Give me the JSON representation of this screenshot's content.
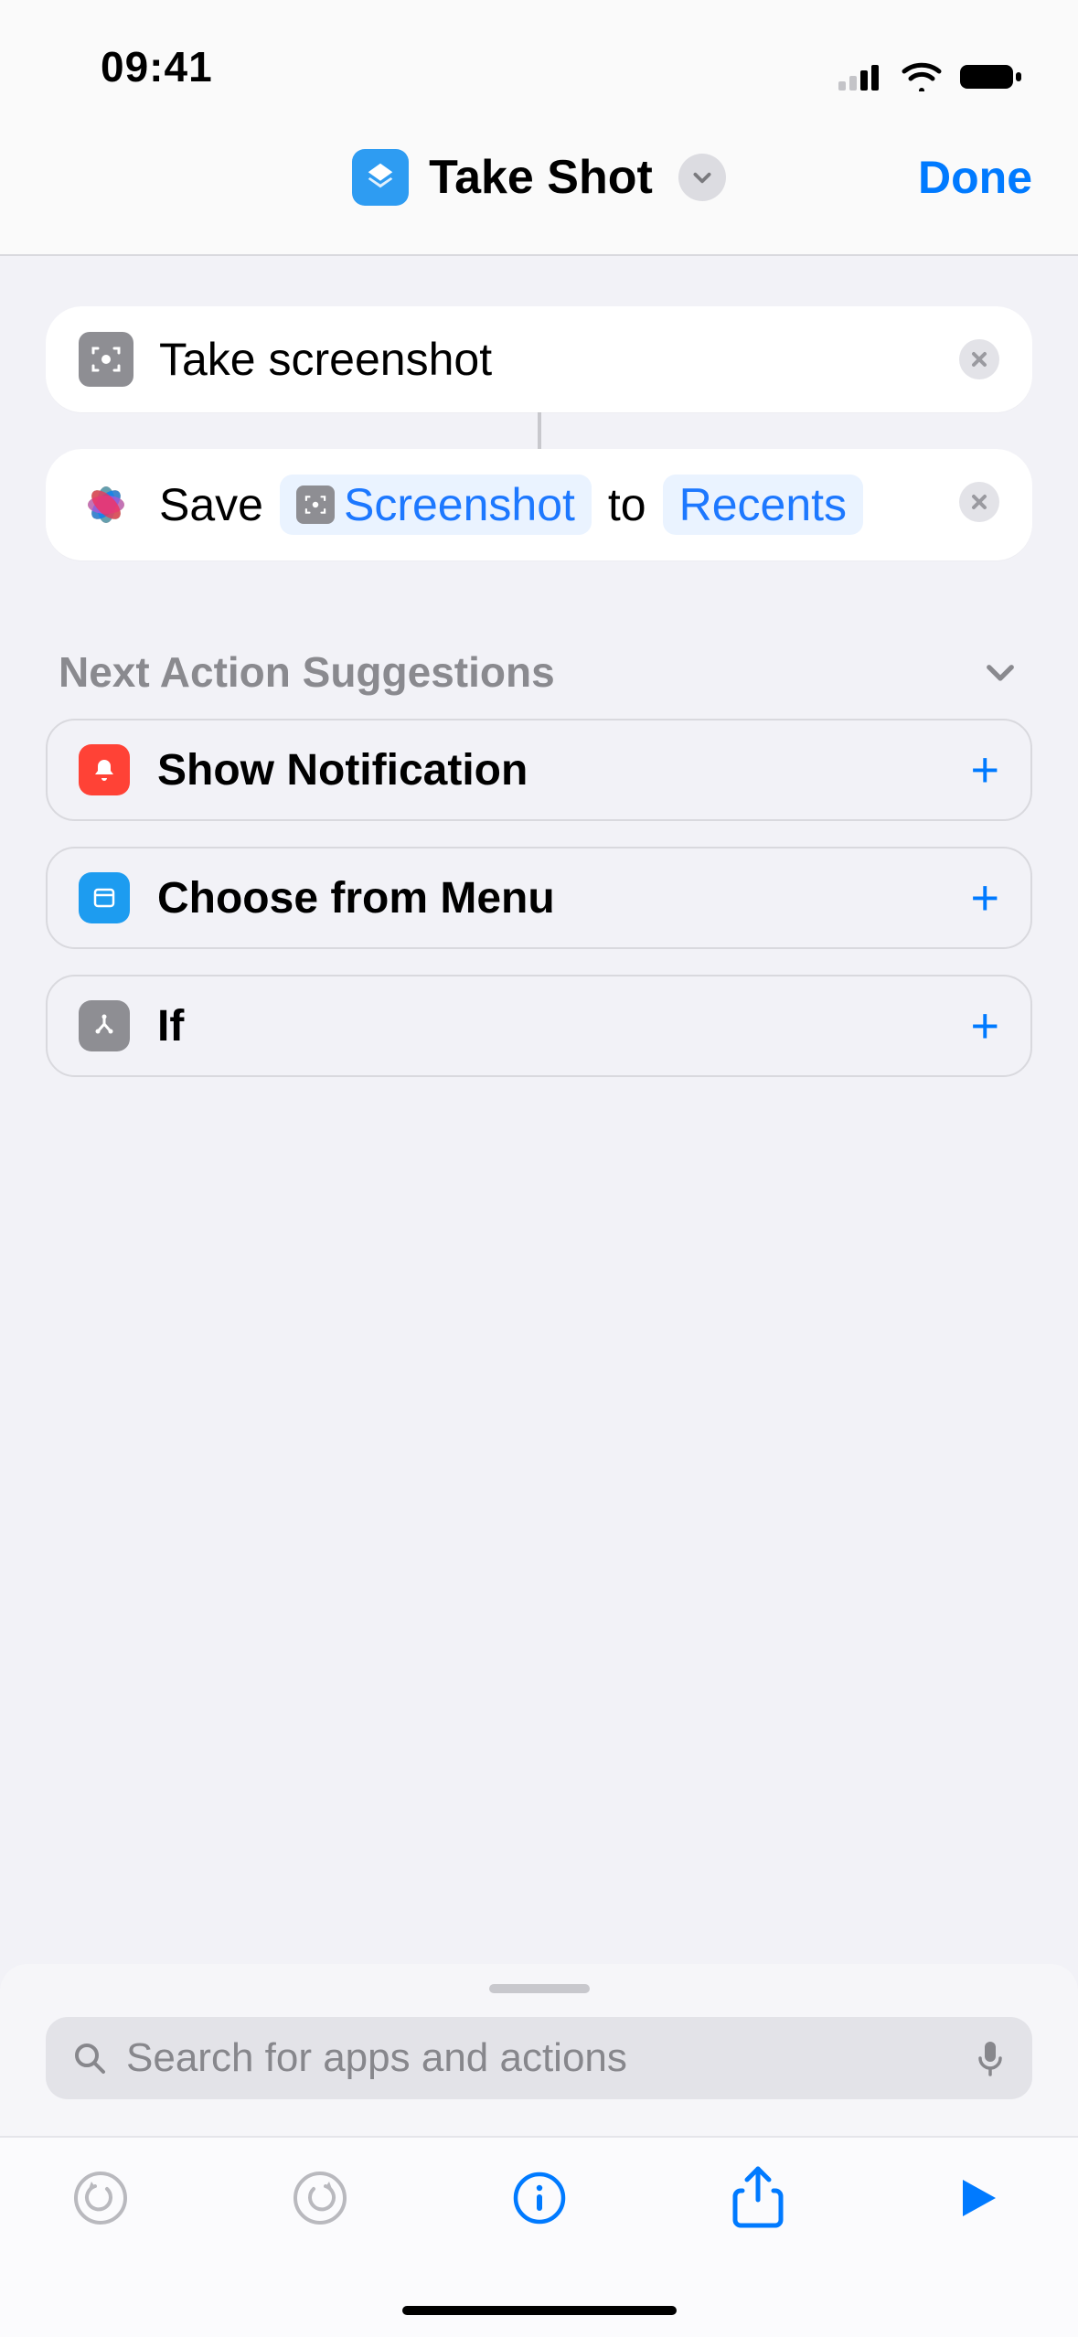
{
  "status": {
    "time": "09:41"
  },
  "nav": {
    "title": "Take Shot",
    "done": "Done"
  },
  "actions": {
    "a1": {
      "label": "Take screenshot"
    },
    "a2": {
      "save_word": "Save",
      "var_name": "Screenshot",
      "to_word": "to",
      "dest": "Recents"
    }
  },
  "suggestions": {
    "header": "Next Action Suggestions",
    "items": [
      {
        "label": "Show Notification"
      },
      {
        "label": "Choose from Menu"
      },
      {
        "label": "If"
      }
    ]
  },
  "search": {
    "placeholder": "Search for apps and actions"
  }
}
